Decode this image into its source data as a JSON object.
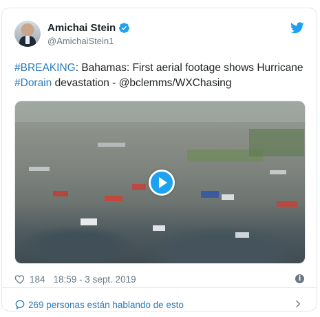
{
  "tweet": {
    "author_name": "Amichai Stein",
    "author_handle": "@AmichaiStein1",
    "text_parts": [
      {
        "text": "#BREAKING",
        "link": true
      },
      {
        "text": ": Bahamas: First aerial footage shows Hurricane ",
        "link": false
      },
      {
        "text": "#Dorain",
        "link": true
      },
      {
        "text": " devastation - @bclemms/WXChasing",
        "link": false
      }
    ],
    "likes": "184",
    "timestamp": "18:59 - 3 sept. 2019",
    "conversation_label": "269 personas están hablando de esto"
  },
  "icons": {
    "verified": "verified-badge-icon",
    "logo": "twitter-bird-icon",
    "like": "heart-icon",
    "info": "info-icon",
    "reply": "speech-bubble-icon",
    "chevron": "chevron-right-icon",
    "play": "play-icon"
  },
  "colors": {
    "accent": "#1da1f2",
    "link": "#2b7bb9",
    "muted": "#697882",
    "text": "#1c2022",
    "border": "#e1e8ed"
  }
}
